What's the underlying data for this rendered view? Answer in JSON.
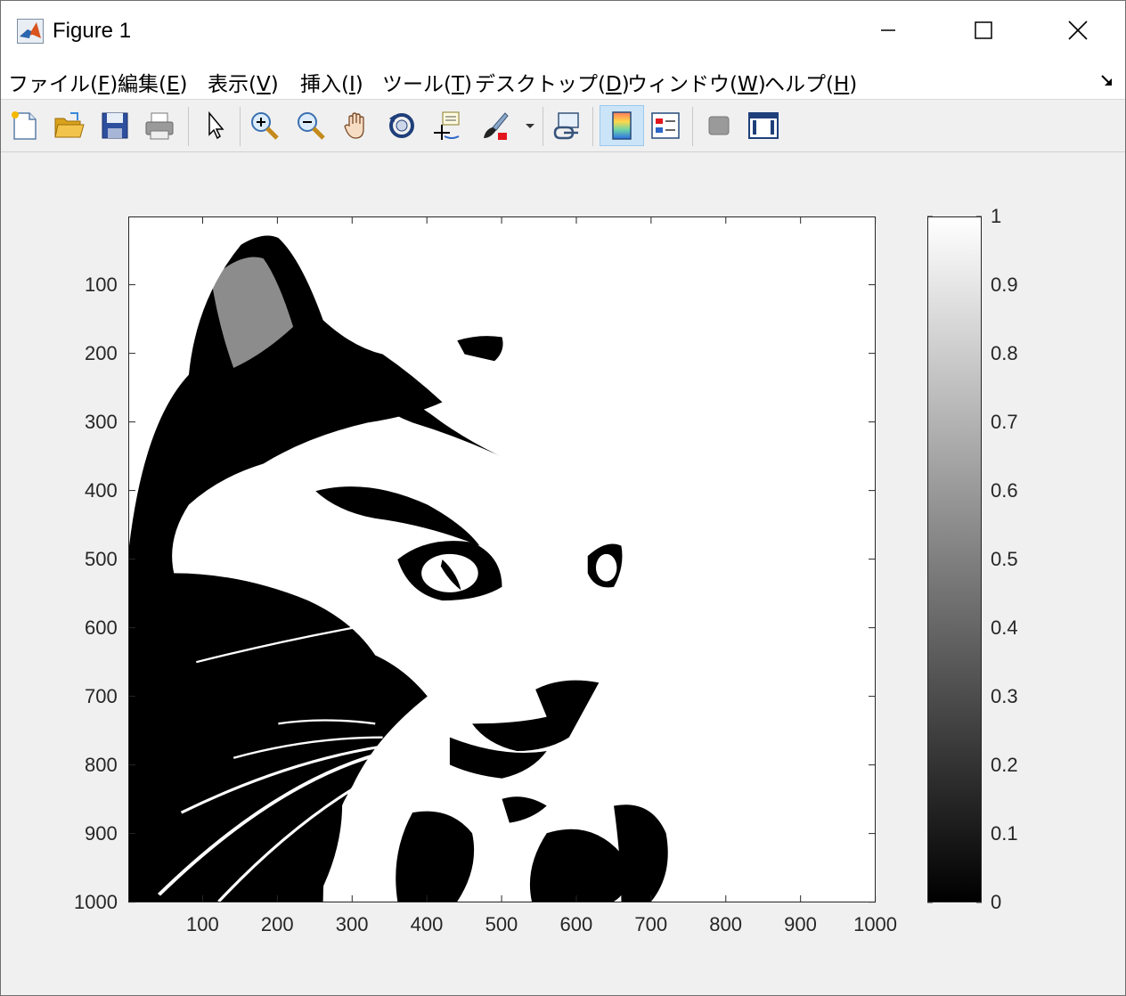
{
  "window": {
    "title": "Figure 1",
    "controls": [
      "minimize",
      "maximize",
      "close"
    ]
  },
  "menubar": {
    "items": [
      {
        "label": "ファイル(",
        "accel": "F",
        "tail": ")"
      },
      {
        "label": "編集(",
        "accel": "E",
        "tail": ")"
      },
      {
        "label": "表示(",
        "accel": "V",
        "tail": ")"
      },
      {
        "label": "挿入(",
        "accel": "I",
        "tail": ")"
      },
      {
        "label": "ツール(",
        "accel": "T",
        "tail": ")"
      },
      {
        "label": "デスクトップ(",
        "accel": "D",
        "tail": ")"
      },
      {
        "label": "ウィンドウ(",
        "accel": "W",
        "tail": ")"
      },
      {
        "label": "ヘルプ(",
        "accel": "H",
        "tail": ")"
      }
    ]
  },
  "toolbar": {
    "buttons": [
      "new-figure-icon",
      "open-file-icon",
      "save-icon",
      "print-icon",
      "pointer-icon",
      "zoom-in-icon",
      "zoom-out-icon",
      "pan-hand-icon",
      "rotate-3d-icon",
      "data-cursor-icon",
      "brush-icon",
      "brush-dropdown-icon",
      "link-plot-icon",
      "colorbar-icon",
      "legend-icon",
      "hide-plot-tools-icon",
      "show-plot-tools-icon"
    ],
    "active": "colorbar-icon"
  },
  "axes": {
    "x_ticks": [
      "100",
      "200",
      "300",
      "400",
      "500",
      "600",
      "700",
      "800",
      "900",
      "1000"
    ],
    "y_ticks": [
      "100",
      "200",
      "300",
      "400",
      "500",
      "600",
      "700",
      "800",
      "900",
      "1000"
    ]
  },
  "colorbar": {
    "ticks": [
      "0",
      "0.1",
      "0.2",
      "0.3",
      "0.4",
      "0.5",
      "0.6",
      "0.7",
      "0.8",
      "0.9",
      "1"
    ],
    "colormap": [
      "#000000",
      "#ffffff"
    ]
  },
  "chart_data": {
    "type": "heatmap",
    "title": "",
    "xlabel": "",
    "ylabel": "",
    "xlim": [
      0.5,
      1000.5
    ],
    "ylim": [
      0.5,
      1000.5
    ],
    "y_direction": "reverse",
    "clim": [
      0,
      1
    ],
    "colormap": "gray",
    "colorbar": "right",
    "values_present": [
      0,
      1
    ]
  }
}
